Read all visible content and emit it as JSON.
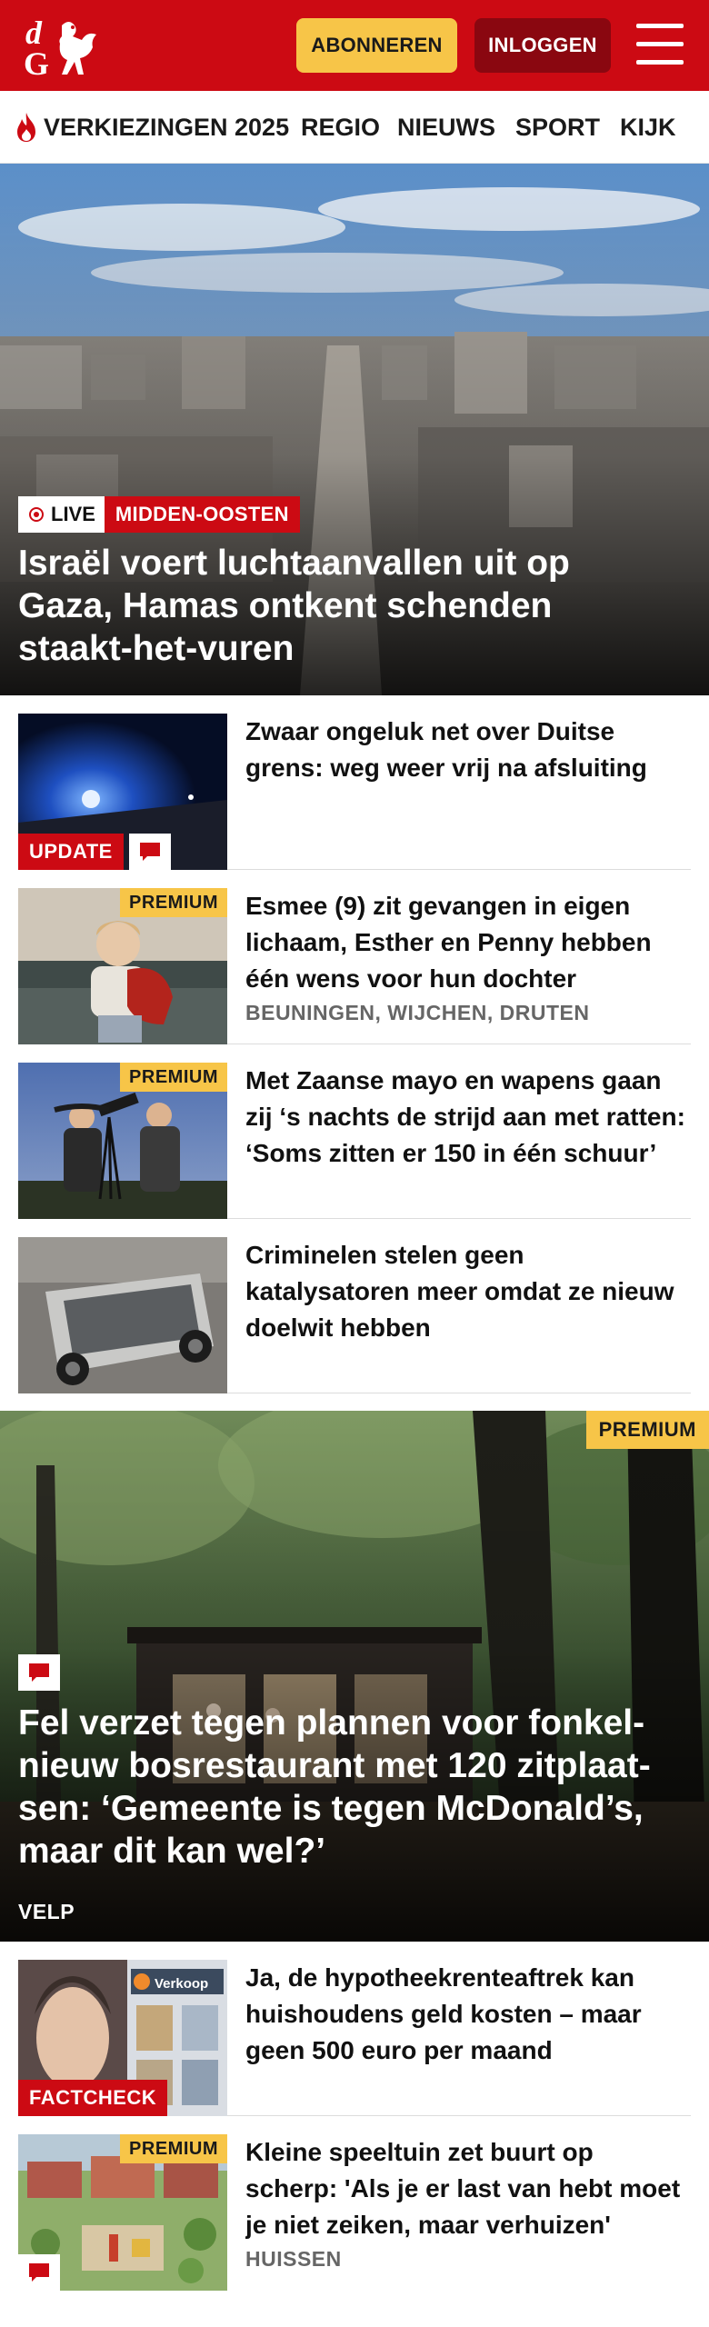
{
  "header": {
    "logo_text": "dG",
    "subscribe_label": "ABONNEREN",
    "login_label": "INLOGGEN",
    "brand_color": "#cc0a13"
  },
  "nav": {
    "items": [
      {
        "label": "VERKIEZINGEN 2025",
        "icon": "flame-icon"
      },
      {
        "label": "REGIO"
      },
      {
        "label": "NIEUWS"
      },
      {
        "label": "SPORT"
      },
      {
        "label": "KIJK"
      }
    ]
  },
  "hero": {
    "live_label": "LIVE",
    "category": "MIDDEN-OOSTEN",
    "title": "Israël voert luchtaanvallen uit op Gaza, Hamas ontkent schenden staakt-het-vuren"
  },
  "articles": [
    {
      "title": "Zwaar ongeluk net over Duitse grens: weg weer vrij na afsluiting",
      "badge": "UPDATE",
      "has_comments": true
    },
    {
      "title": "Esmee (9) zit gevangen in eigen lichaam, Esther en Penny hebben één wens voor hun dochter",
      "badge": "PREMIUM",
      "location": "BEUNINGEN, WIJCHEN, DRUTEN"
    },
    {
      "title": "Met Zaanse mayo en wapens gaan zij ‘s nachts de strijd aan met ratten: ‘Soms zitten er 150 in één schuur’",
      "badge": "PREMIUM"
    },
    {
      "title": "Criminelen stelen geen katalysatoren meer omdat ze nieuw doelwit hebben"
    }
  ],
  "feature": {
    "badge": "PREMIUM",
    "title": "Fel verzet tegen plannen voor fonkel­nieuw bosrestaurant met 120 zitplaat­sen: ‘Gemeente is tegen McDonald’s, maar dit kan wel?’",
    "location": "VELP"
  },
  "articles2": [
    {
      "title": "Ja, de hypotheekrenteaftrek kan huishoudens geld kosten – maar geen 500 euro per maand",
      "badge": "FACTCHECK",
      "sign_text": "Verkoop"
    },
    {
      "title": "Kleine speeltuin zet buurt op scherp: 'Als je er last van hebt moet je niet zeiken, maar verhuizen'",
      "badge": "PREMIUM",
      "location": "HUISSEN",
      "has_comments": true
    }
  ],
  "colors": {
    "premium": "#f7c548",
    "red": "#cc0a13",
    "dark_red": "#8a0710"
  }
}
